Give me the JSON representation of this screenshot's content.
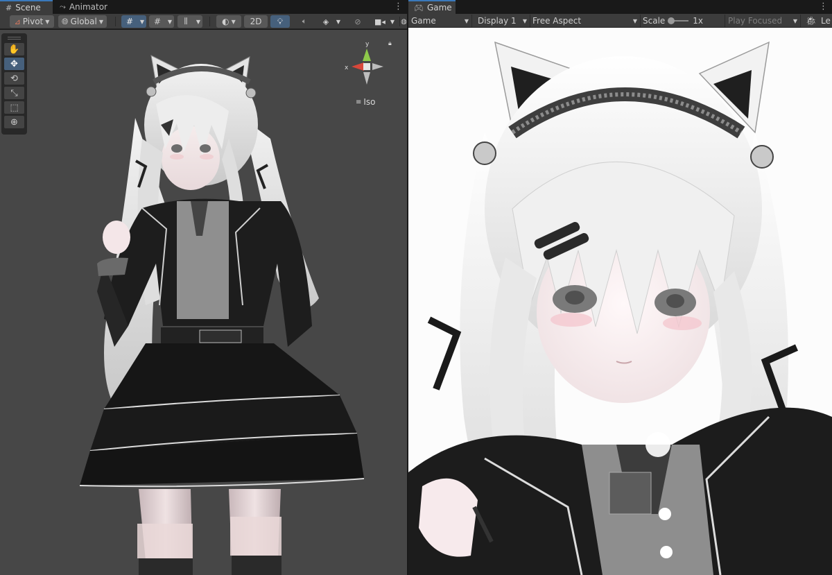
{
  "scene_panel": {
    "tabs": [
      {
        "label": "Scene",
        "icon": "hash-grid-icon",
        "active": true
      },
      {
        "label": "Animator",
        "icon": "animator-icon",
        "active": false
      }
    ],
    "toolbar": {
      "pivot_label": "Pivot",
      "global_label": "Global",
      "mode_2d_label": "2D"
    },
    "tools": [
      {
        "name": "hand-tool",
        "icon": "hand-icon",
        "glyph": "✋",
        "active": false
      },
      {
        "name": "move-tool",
        "icon": "move-arrows-icon",
        "glyph": "✥",
        "active": true
      },
      {
        "name": "rotate-tool",
        "icon": "rotate-icon",
        "glyph": "⟲",
        "active": false
      },
      {
        "name": "scale-tool",
        "icon": "scale-icon",
        "glyph": "⤡",
        "active": false
      },
      {
        "name": "rect-tool",
        "icon": "rect-icon",
        "glyph": "⬚",
        "active": false
      },
      {
        "name": "transform-tool",
        "icon": "transform-icon",
        "glyph": "⊕",
        "active": false
      }
    ],
    "gizmo": {
      "axis_x_label": "x",
      "axis_y_label": "y",
      "projection_label": "Iso",
      "x_color": "#d8473a",
      "y_color": "#8ec94a"
    }
  },
  "game_panel": {
    "tab": {
      "label": "Game",
      "icon": "gamepad-icon"
    },
    "toolbar": {
      "view_label": "Game",
      "display_label": "Display 1",
      "aspect_label": "Free Aspect",
      "scale_label": "Scale",
      "scale_value": "1x",
      "play_mode_label": "Play Focused",
      "cut_label": "Le"
    }
  },
  "colors": {
    "accent": "#3a79bb",
    "active_button": "#46607c",
    "viewport_bg": "#474747"
  }
}
